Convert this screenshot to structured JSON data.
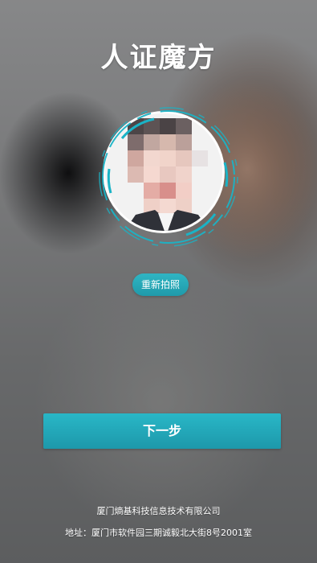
{
  "header": {
    "logo_text": "人证魔方"
  },
  "face_capture": {
    "retake_label": "重新拍照"
  },
  "actions": {
    "next_label": "下一步"
  },
  "footer": {
    "company": "厦门熵基科技信息技术有限公司",
    "address": "地址：厦门市软件园三期诚毅北大街8号2001室"
  },
  "colors": {
    "accent": "#1fa6b7"
  }
}
